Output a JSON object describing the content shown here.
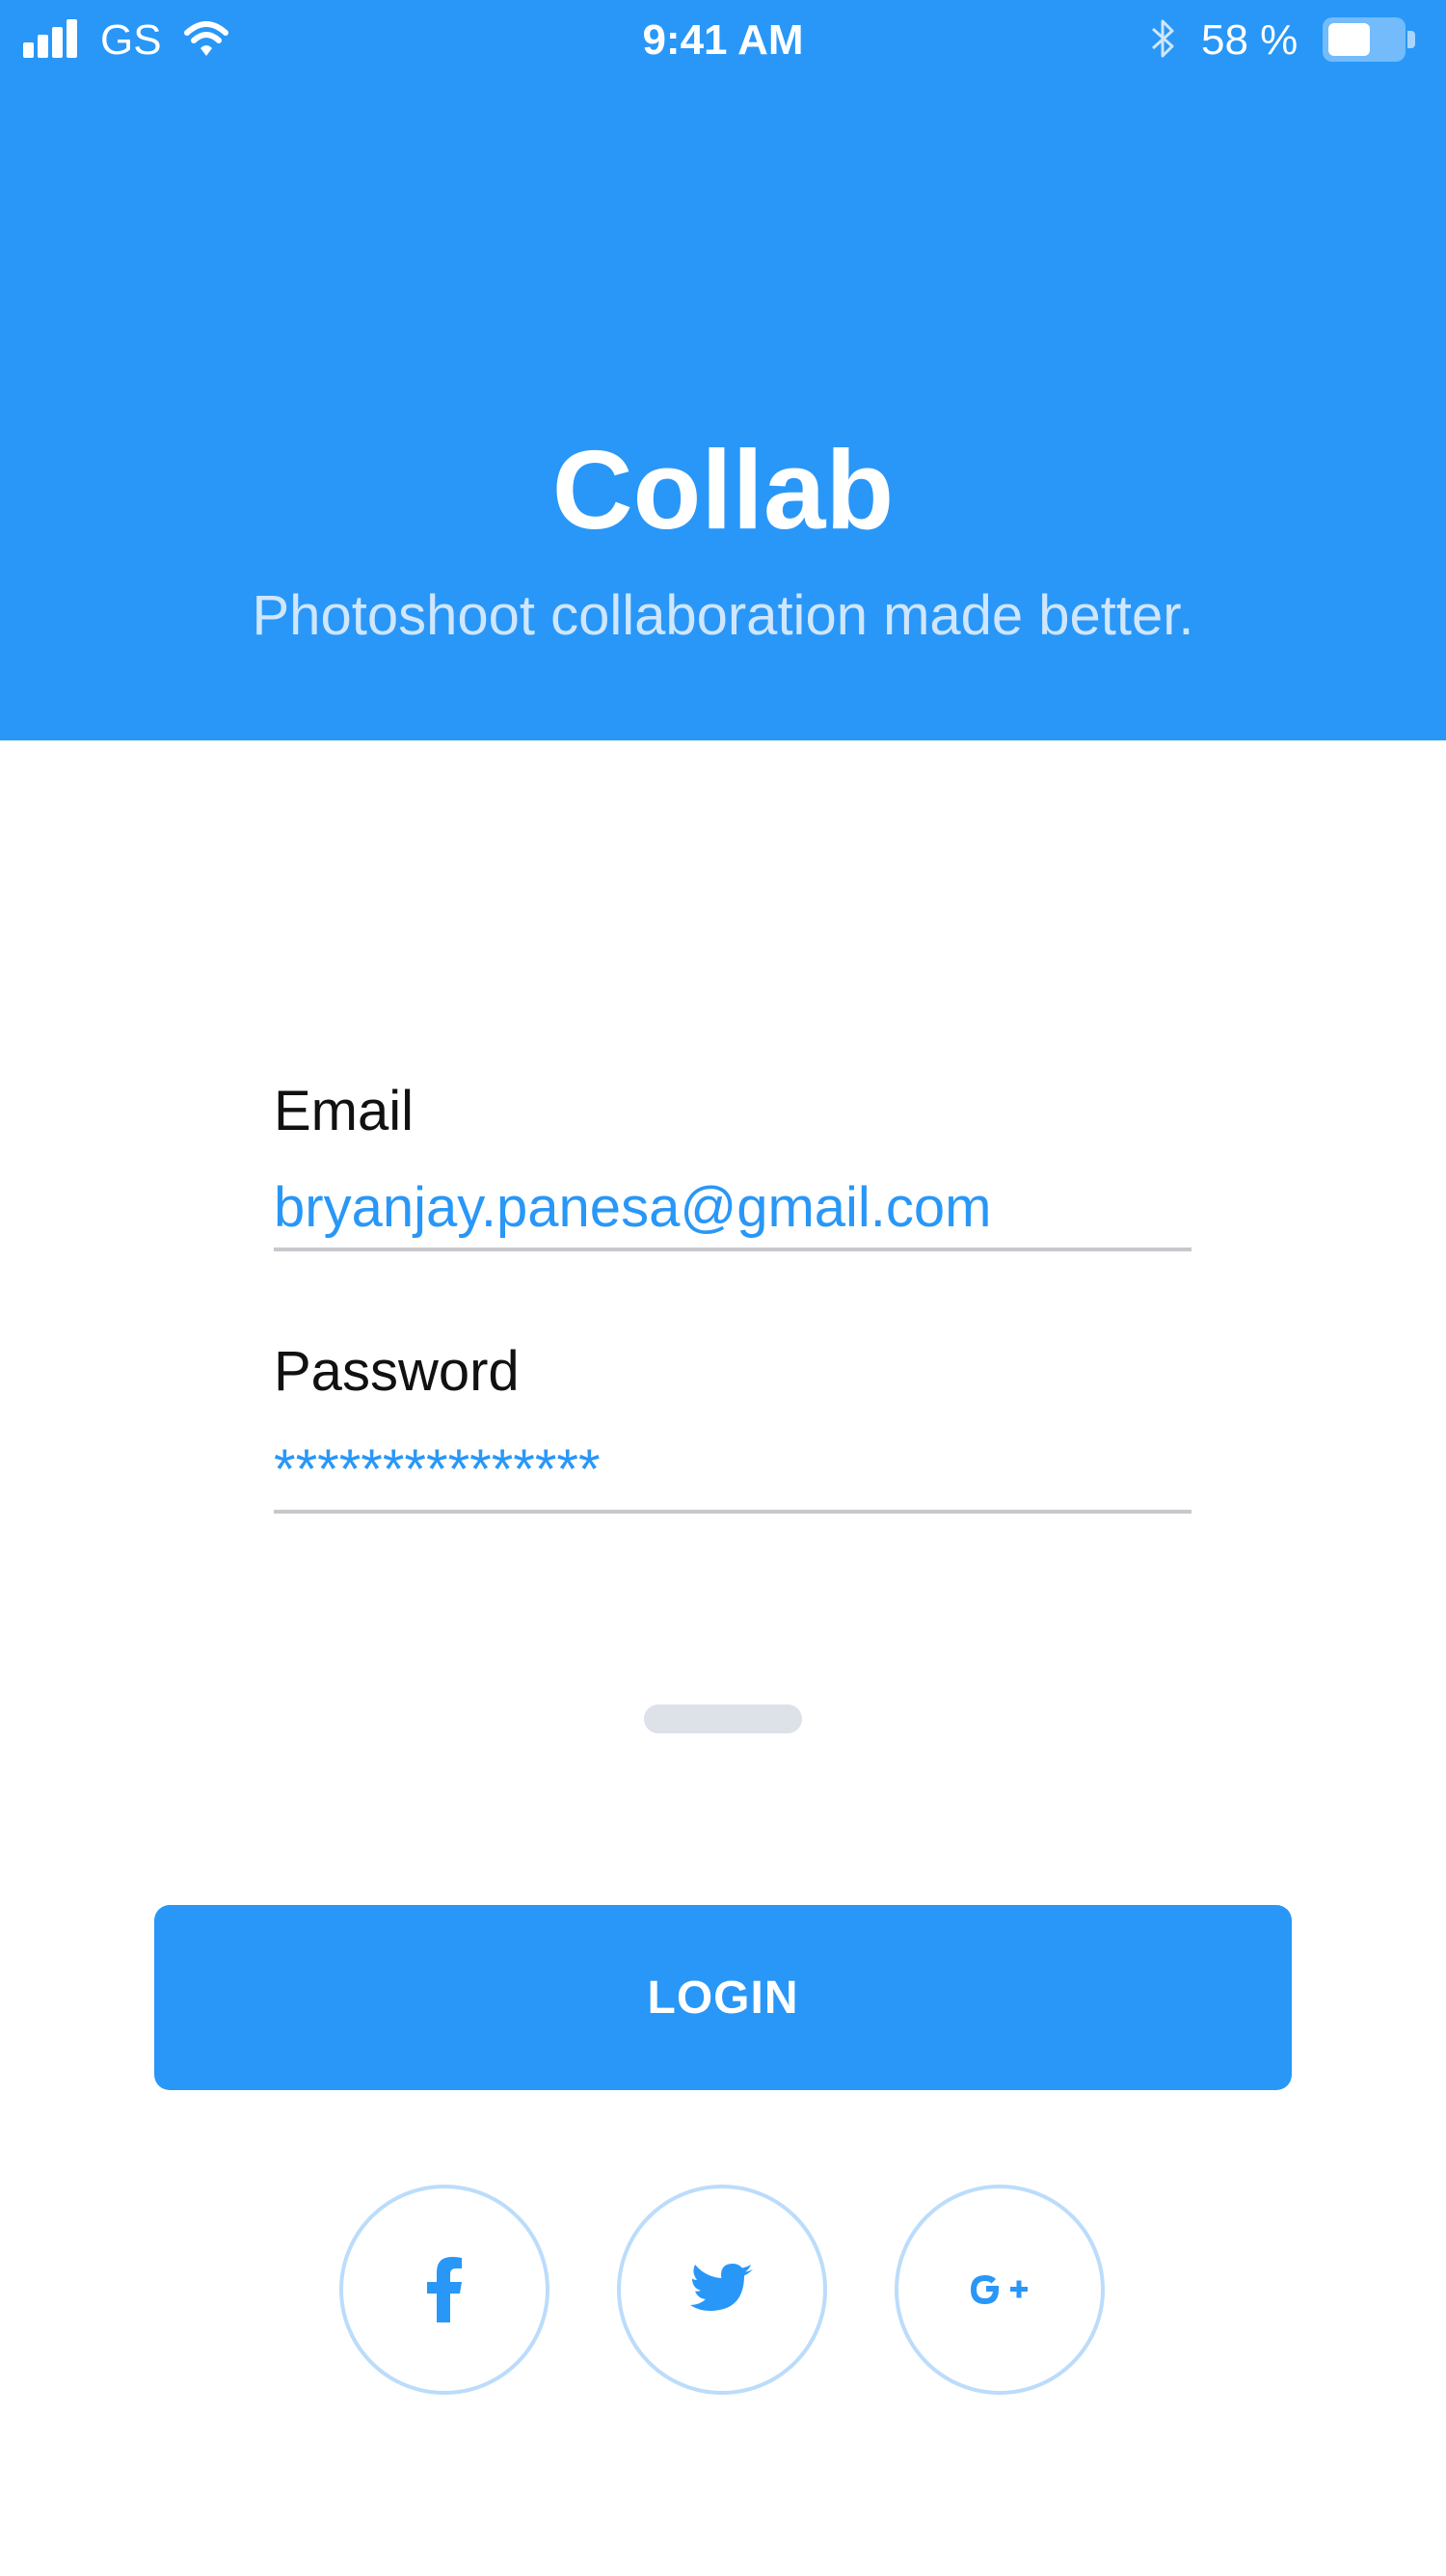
{
  "colors": {
    "primary": "#2997f7",
    "subtitle": "#cfe6fd",
    "underline": "#c8c8cc",
    "social_border": "#bcdcfb"
  },
  "status_bar": {
    "carrier": "GS",
    "time": "9:41 AM",
    "battery_percent": "58 %",
    "battery_level": 0.58,
    "icons": [
      "signal-bars-icon",
      "wifi-icon",
      "bluetooth-icon",
      "battery-icon"
    ]
  },
  "header": {
    "title": "Collab",
    "subtitle": "Photoshoot collaboration made better."
  },
  "form": {
    "email_label": "Email",
    "email_value": "bryanjay.panesa@gmail.com",
    "password_label": "Password",
    "password_value": "***************"
  },
  "login_button": {
    "label": "LOGIN"
  },
  "social_buttons": [
    {
      "icon": "facebook-icon"
    },
    {
      "icon": "twitter-icon"
    },
    {
      "icon": "google-plus-icon"
    }
  ]
}
